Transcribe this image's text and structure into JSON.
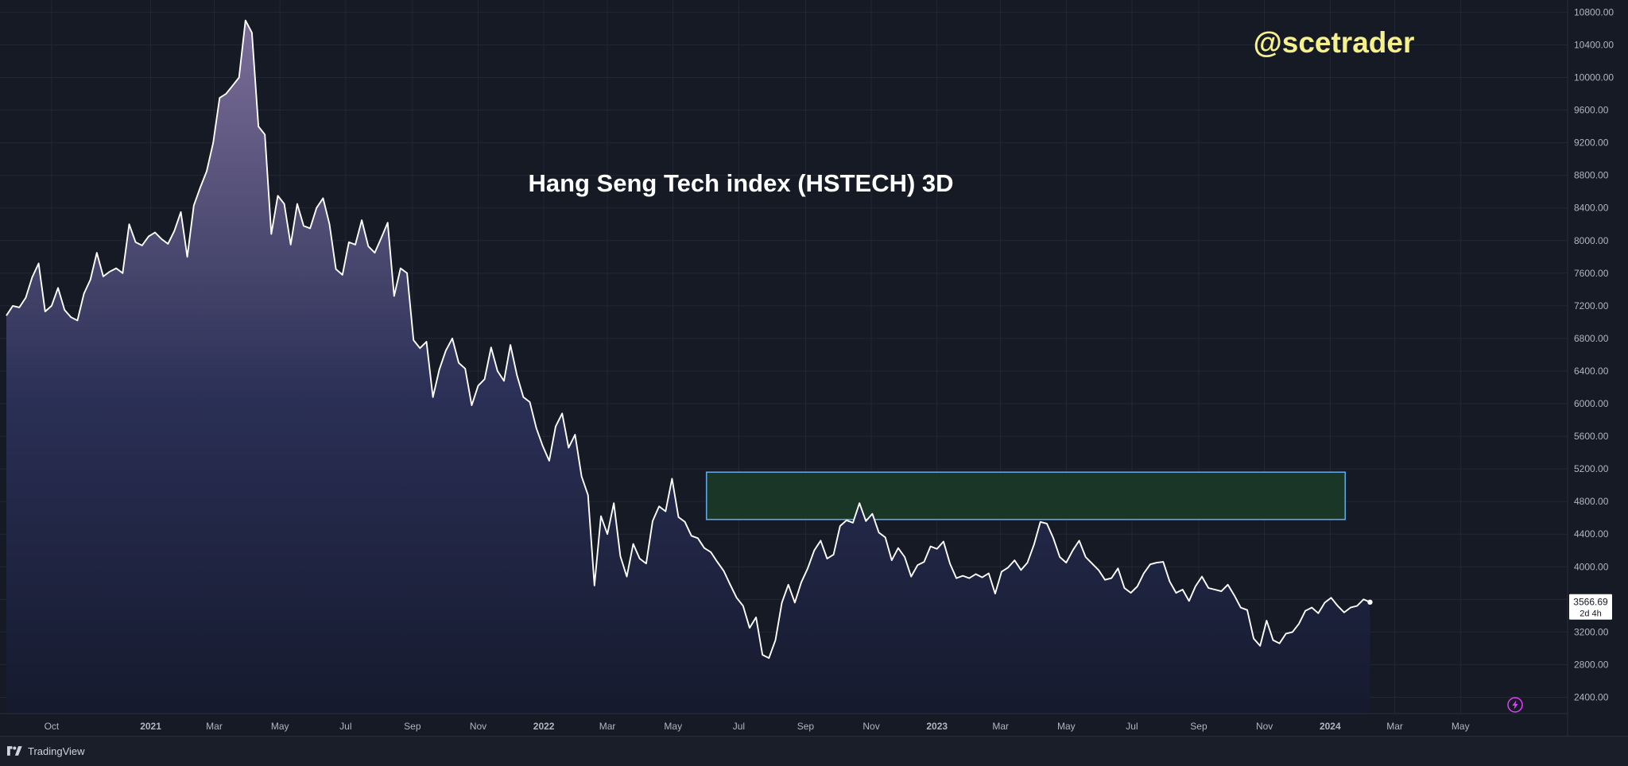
{
  "chart_data": {
    "type": "area",
    "title": "Hang Seng Tech index (HSTECH) 3D",
    "watermark": "@scetrader",
    "x_tick_labels": [
      "Oct",
      "2021",
      "Mar",
      "May",
      "Jul",
      "Sep",
      "Nov",
      "2022",
      "Mar",
      "May",
      "Jul",
      "Sep",
      "Nov",
      "2023",
      "Mar",
      "May",
      "Jul",
      "Sep",
      "Nov",
      "2024",
      "Mar",
      "May"
    ],
    "y_tick_labels": [
      "10800.00",
      "10400.00",
      "10000.00",
      "9600.00",
      "9200.00",
      "8800.00",
      "8400.00",
      "8000.00",
      "7600.00",
      "7200.00",
      "6800.00",
      "6400.00",
      "6000.00",
      "5600.00",
      "5200.00",
      "4800.00",
      "4400.00",
      "4000.00",
      "3600.00",
      "3200.00",
      "2800.00",
      "2400.00"
    ],
    "ylim": [
      2200,
      10950
    ],
    "xlim": [
      "2020-08-20",
      "2024-06-20"
    ],
    "last_price": {
      "value": "3566.69",
      "countdown": "2d 4h"
    },
    "zone": {
      "x_start": "2022-06-01",
      "x_end": "2024-01-15",
      "y_low": 4580,
      "y_high": 5160
    },
    "series": [
      {
        "points": [
          [
            "2020-08-20",
            7080
          ],
          [
            "2020-08-26",
            7200
          ],
          [
            "2020-09-01",
            7180
          ],
          [
            "2020-09-07",
            7300
          ],
          [
            "2020-09-13",
            7550
          ],
          [
            "2020-09-19",
            7720
          ],
          [
            "2020-09-25",
            7130
          ],
          [
            "2020-10-01",
            7200
          ],
          [
            "2020-10-07",
            7420
          ],
          [
            "2020-10-13",
            7150
          ],
          [
            "2020-10-19",
            7060
          ],
          [
            "2020-10-25",
            7020
          ],
          [
            "2020-10-31",
            7350
          ],
          [
            "2020-11-06",
            7520
          ],
          [
            "2020-11-12",
            7850
          ],
          [
            "2020-11-18",
            7560
          ],
          [
            "2020-11-24",
            7620
          ],
          [
            "2020-11-30",
            7660
          ],
          [
            "2020-12-06",
            7600
          ],
          [
            "2020-12-12",
            8200
          ],
          [
            "2020-12-18",
            7980
          ],
          [
            "2020-12-24",
            7940
          ],
          [
            "2020-12-30",
            8050
          ],
          [
            "2021-01-05",
            8100
          ],
          [
            "2021-01-11",
            8020
          ],
          [
            "2021-01-17",
            7960
          ],
          [
            "2021-01-23",
            8120
          ],
          [
            "2021-01-29",
            8350
          ],
          [
            "2021-02-04",
            7800
          ],
          [
            "2021-02-10",
            8430
          ],
          [
            "2021-02-16",
            8650
          ],
          [
            "2021-02-22",
            8850
          ],
          [
            "2021-02-28",
            9200
          ],
          [
            "2021-03-06",
            9750
          ],
          [
            "2021-03-12",
            9800
          ],
          [
            "2021-03-18",
            9900
          ],
          [
            "2021-03-24",
            10000
          ],
          [
            "2021-03-30",
            10700
          ],
          [
            "2021-04-05",
            10550
          ],
          [
            "2021-04-11",
            9400
          ],
          [
            "2021-04-17",
            9300
          ],
          [
            "2021-04-23",
            8080
          ],
          [
            "2021-04-29",
            8550
          ],
          [
            "2021-05-05",
            8450
          ],
          [
            "2021-05-11",
            7950
          ],
          [
            "2021-05-17",
            8450
          ],
          [
            "2021-05-23",
            8180
          ],
          [
            "2021-05-29",
            8150
          ],
          [
            "2021-06-04",
            8400
          ],
          [
            "2021-06-10",
            8520
          ],
          [
            "2021-06-16",
            8200
          ],
          [
            "2021-06-22",
            7650
          ],
          [
            "2021-06-28",
            7580
          ],
          [
            "2021-07-04",
            7980
          ],
          [
            "2021-07-10",
            7950
          ],
          [
            "2021-07-16",
            8250
          ],
          [
            "2021-07-22",
            7930
          ],
          [
            "2021-07-28",
            7850
          ],
          [
            "2021-08-03",
            8030
          ],
          [
            "2021-08-09",
            8220
          ],
          [
            "2021-08-15",
            7320
          ],
          [
            "2021-08-21",
            7660
          ],
          [
            "2021-08-27",
            7600
          ],
          [
            "2021-09-02",
            6780
          ],
          [
            "2021-09-08",
            6680
          ],
          [
            "2021-09-14",
            6760
          ],
          [
            "2021-09-20",
            6080
          ],
          [
            "2021-09-26",
            6420
          ],
          [
            "2021-10-02",
            6650
          ],
          [
            "2021-10-08",
            6800
          ],
          [
            "2021-10-14",
            6500
          ],
          [
            "2021-10-20",
            6430
          ],
          [
            "2021-10-26",
            5980
          ],
          [
            "2021-11-01",
            6220
          ],
          [
            "2021-11-07",
            6300
          ],
          [
            "2021-11-13",
            6690
          ],
          [
            "2021-11-19",
            6400
          ],
          [
            "2021-11-25",
            6280
          ],
          [
            "2021-12-01",
            6720
          ],
          [
            "2021-12-07",
            6350
          ],
          [
            "2021-12-13",
            6080
          ],
          [
            "2021-12-19",
            6020
          ],
          [
            "2021-12-25",
            5700
          ],
          [
            "2021-12-31",
            5480
          ],
          [
            "2022-01-06",
            5300
          ],
          [
            "2022-01-12",
            5720
          ],
          [
            "2022-01-18",
            5880
          ],
          [
            "2022-01-24",
            5460
          ],
          [
            "2022-01-30",
            5620
          ],
          [
            "2022-02-05",
            5110
          ],
          [
            "2022-02-11",
            4880
          ],
          [
            "2022-02-17",
            3770
          ],
          [
            "2022-02-23",
            4620
          ],
          [
            "2022-03-01",
            4400
          ],
          [
            "2022-03-07",
            4780
          ],
          [
            "2022-03-13",
            4130
          ],
          [
            "2022-03-19",
            3880
          ],
          [
            "2022-03-25",
            4280
          ],
          [
            "2022-03-31",
            4100
          ],
          [
            "2022-04-06",
            4040
          ],
          [
            "2022-04-12",
            4560
          ],
          [
            "2022-04-18",
            4740
          ],
          [
            "2022-04-24",
            4680
          ],
          [
            "2022-04-30",
            5080
          ],
          [
            "2022-05-06",
            4610
          ],
          [
            "2022-05-12",
            4550
          ],
          [
            "2022-05-18",
            4380
          ],
          [
            "2022-05-24",
            4350
          ],
          [
            "2022-05-30",
            4230
          ],
          [
            "2022-06-05",
            4180
          ],
          [
            "2022-06-11",
            4060
          ],
          [
            "2022-06-17",
            3950
          ],
          [
            "2022-06-23",
            3780
          ],
          [
            "2022-06-29",
            3620
          ],
          [
            "2022-07-05",
            3520
          ],
          [
            "2022-07-11",
            3250
          ],
          [
            "2022-07-17",
            3380
          ],
          [
            "2022-07-23",
            2920
          ],
          [
            "2022-07-29",
            2880
          ],
          [
            "2022-08-04",
            3100
          ],
          [
            "2022-08-10",
            3560
          ],
          [
            "2022-08-16",
            3780
          ],
          [
            "2022-08-22",
            3560
          ],
          [
            "2022-08-28",
            3810
          ],
          [
            "2022-09-03",
            3980
          ],
          [
            "2022-09-09",
            4200
          ],
          [
            "2022-09-15",
            4320
          ],
          [
            "2022-09-21",
            4100
          ],
          [
            "2022-09-27",
            4150
          ],
          [
            "2022-10-03",
            4500
          ],
          [
            "2022-10-09",
            4570
          ],
          [
            "2022-10-15",
            4540
          ],
          [
            "2022-10-21",
            4780
          ],
          [
            "2022-10-27",
            4560
          ],
          [
            "2022-11-02",
            4650
          ],
          [
            "2022-11-08",
            4420
          ],
          [
            "2022-11-14",
            4360
          ],
          [
            "2022-11-20",
            4080
          ],
          [
            "2022-11-26",
            4230
          ],
          [
            "2022-12-02",
            4120
          ],
          [
            "2022-12-08",
            3880
          ],
          [
            "2022-12-14",
            4020
          ],
          [
            "2022-12-20",
            4060
          ],
          [
            "2022-12-26",
            4250
          ],
          [
            "2023-01-01",
            4220
          ],
          [
            "2023-01-07",
            4310
          ],
          [
            "2023-01-13",
            4040
          ],
          [
            "2023-01-19",
            3860
          ],
          [
            "2023-01-25",
            3890
          ],
          [
            "2023-01-31",
            3860
          ],
          [
            "2023-02-06",
            3910
          ],
          [
            "2023-02-12",
            3870
          ],
          [
            "2023-02-18",
            3920
          ],
          [
            "2023-02-24",
            3670
          ],
          [
            "2023-03-02",
            3940
          ],
          [
            "2023-03-08",
            3990
          ],
          [
            "2023-03-14",
            4080
          ],
          [
            "2023-03-20",
            3960
          ],
          [
            "2023-03-26",
            4050
          ],
          [
            "2023-04-01",
            4270
          ],
          [
            "2023-04-07",
            4550
          ],
          [
            "2023-04-13",
            4530
          ],
          [
            "2023-04-19",
            4350
          ],
          [
            "2023-04-25",
            4120
          ],
          [
            "2023-05-01",
            4050
          ],
          [
            "2023-05-07",
            4200
          ],
          [
            "2023-05-13",
            4320
          ],
          [
            "2023-05-19",
            4120
          ],
          [
            "2023-05-25",
            4040
          ],
          [
            "2023-05-31",
            3960
          ],
          [
            "2023-06-06",
            3840
          ],
          [
            "2023-06-12",
            3860
          ],
          [
            "2023-06-18",
            3980
          ],
          [
            "2023-06-24",
            3740
          ],
          [
            "2023-06-30",
            3680
          ],
          [
            "2023-07-06",
            3760
          ],
          [
            "2023-07-12",
            3920
          ],
          [
            "2023-07-18",
            4030
          ],
          [
            "2023-07-24",
            4050
          ],
          [
            "2023-07-30",
            4060
          ],
          [
            "2023-08-05",
            3820
          ],
          [
            "2023-08-11",
            3680
          ],
          [
            "2023-08-17",
            3720
          ],
          [
            "2023-08-23",
            3580
          ],
          [
            "2023-08-29",
            3760
          ],
          [
            "2023-09-04",
            3880
          ],
          [
            "2023-09-10",
            3740
          ],
          [
            "2023-09-16",
            3720
          ],
          [
            "2023-09-22",
            3700
          ],
          [
            "2023-09-28",
            3780
          ],
          [
            "2023-10-04",
            3650
          ],
          [
            "2023-10-10",
            3500
          ],
          [
            "2023-10-16",
            3470
          ],
          [
            "2023-10-22",
            3120
          ],
          [
            "2023-10-28",
            3030
          ],
          [
            "2023-11-03",
            3340
          ],
          [
            "2023-11-09",
            3100
          ],
          [
            "2023-11-15",
            3060
          ],
          [
            "2023-11-21",
            3180
          ],
          [
            "2023-11-27",
            3200
          ],
          [
            "2023-12-03",
            3300
          ],
          [
            "2023-12-09",
            3460
          ],
          [
            "2023-12-15",
            3500
          ],
          [
            "2023-12-21",
            3430
          ],
          [
            "2023-12-27",
            3560
          ],
          [
            "2024-01-02",
            3620
          ],
          [
            "2024-01-08",
            3520
          ],
          [
            "2024-01-14",
            3440
          ],
          [
            "2024-01-20",
            3500
          ],
          [
            "2024-01-26",
            3520
          ],
          [
            "2024-02-01",
            3600
          ],
          [
            "2024-02-07",
            3566
          ]
        ]
      }
    ],
    "grid": true,
    "colors": {
      "line": "#ffffff",
      "fill_top": "#7b6e98",
      "fill_bottom": "#151a2e",
      "zone_fill": "#1b3a28",
      "zone_border": "#5fa6e6",
      "watermark": "#f6f18a",
      "title": "#ffffff",
      "axis_text": "#b2b5be",
      "grid": "#232734",
      "background": "#161a25"
    }
  },
  "footer": {
    "brand": "TradingView"
  }
}
